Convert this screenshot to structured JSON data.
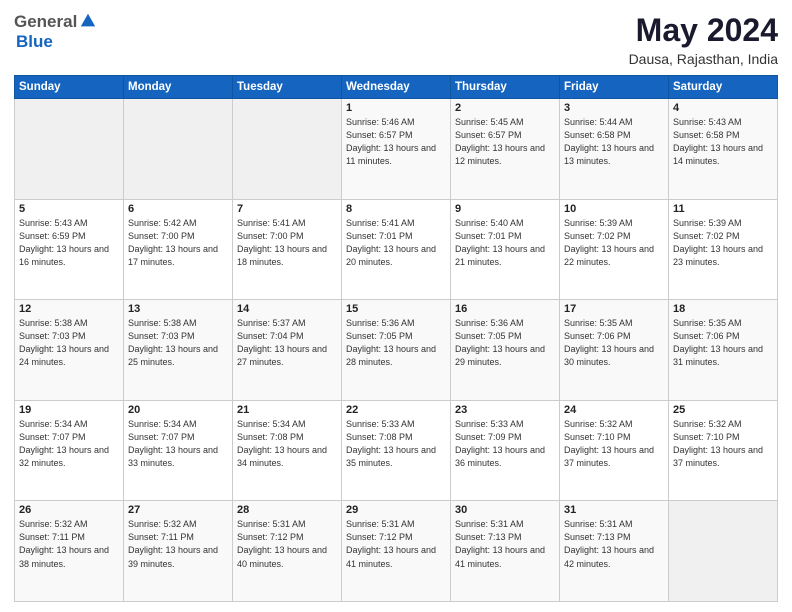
{
  "logo": {
    "general": "General",
    "blue": "Blue"
  },
  "title": "May 2024",
  "subtitle": "Dausa, Rajasthan, India",
  "days_header": [
    "Sunday",
    "Monday",
    "Tuesday",
    "Wednesday",
    "Thursday",
    "Friday",
    "Saturday"
  ],
  "weeks": [
    [
      {
        "day": "",
        "info": ""
      },
      {
        "day": "",
        "info": ""
      },
      {
        "day": "",
        "info": ""
      },
      {
        "day": "1",
        "info": "Sunrise: 5:46 AM\nSunset: 6:57 PM\nDaylight: 13 hours\nand 11 minutes."
      },
      {
        "day": "2",
        "info": "Sunrise: 5:45 AM\nSunset: 6:57 PM\nDaylight: 13 hours\nand 12 minutes."
      },
      {
        "day": "3",
        "info": "Sunrise: 5:44 AM\nSunset: 6:58 PM\nDaylight: 13 hours\nand 13 minutes."
      },
      {
        "day": "4",
        "info": "Sunrise: 5:43 AM\nSunset: 6:58 PM\nDaylight: 13 hours\nand 14 minutes."
      }
    ],
    [
      {
        "day": "5",
        "info": "Sunrise: 5:43 AM\nSunset: 6:59 PM\nDaylight: 13 hours\nand 16 minutes."
      },
      {
        "day": "6",
        "info": "Sunrise: 5:42 AM\nSunset: 7:00 PM\nDaylight: 13 hours\nand 17 minutes."
      },
      {
        "day": "7",
        "info": "Sunrise: 5:41 AM\nSunset: 7:00 PM\nDaylight: 13 hours\nand 18 minutes."
      },
      {
        "day": "8",
        "info": "Sunrise: 5:41 AM\nSunset: 7:01 PM\nDaylight: 13 hours\nand 20 minutes."
      },
      {
        "day": "9",
        "info": "Sunrise: 5:40 AM\nSunset: 7:01 PM\nDaylight: 13 hours\nand 21 minutes."
      },
      {
        "day": "10",
        "info": "Sunrise: 5:39 AM\nSunset: 7:02 PM\nDaylight: 13 hours\nand 22 minutes."
      },
      {
        "day": "11",
        "info": "Sunrise: 5:39 AM\nSunset: 7:02 PM\nDaylight: 13 hours\nand 23 minutes."
      }
    ],
    [
      {
        "day": "12",
        "info": "Sunrise: 5:38 AM\nSunset: 7:03 PM\nDaylight: 13 hours\nand 24 minutes."
      },
      {
        "day": "13",
        "info": "Sunrise: 5:38 AM\nSunset: 7:03 PM\nDaylight: 13 hours\nand 25 minutes."
      },
      {
        "day": "14",
        "info": "Sunrise: 5:37 AM\nSunset: 7:04 PM\nDaylight: 13 hours\nand 27 minutes."
      },
      {
        "day": "15",
        "info": "Sunrise: 5:36 AM\nSunset: 7:05 PM\nDaylight: 13 hours\nand 28 minutes."
      },
      {
        "day": "16",
        "info": "Sunrise: 5:36 AM\nSunset: 7:05 PM\nDaylight: 13 hours\nand 29 minutes."
      },
      {
        "day": "17",
        "info": "Sunrise: 5:35 AM\nSunset: 7:06 PM\nDaylight: 13 hours\nand 30 minutes."
      },
      {
        "day": "18",
        "info": "Sunrise: 5:35 AM\nSunset: 7:06 PM\nDaylight: 13 hours\nand 31 minutes."
      }
    ],
    [
      {
        "day": "19",
        "info": "Sunrise: 5:34 AM\nSunset: 7:07 PM\nDaylight: 13 hours\nand 32 minutes."
      },
      {
        "day": "20",
        "info": "Sunrise: 5:34 AM\nSunset: 7:07 PM\nDaylight: 13 hours\nand 33 minutes."
      },
      {
        "day": "21",
        "info": "Sunrise: 5:34 AM\nSunset: 7:08 PM\nDaylight: 13 hours\nand 34 minutes."
      },
      {
        "day": "22",
        "info": "Sunrise: 5:33 AM\nSunset: 7:08 PM\nDaylight: 13 hours\nand 35 minutes."
      },
      {
        "day": "23",
        "info": "Sunrise: 5:33 AM\nSunset: 7:09 PM\nDaylight: 13 hours\nand 36 minutes."
      },
      {
        "day": "24",
        "info": "Sunrise: 5:32 AM\nSunset: 7:10 PM\nDaylight: 13 hours\nand 37 minutes."
      },
      {
        "day": "25",
        "info": "Sunrise: 5:32 AM\nSunset: 7:10 PM\nDaylight: 13 hours\nand 37 minutes."
      }
    ],
    [
      {
        "day": "26",
        "info": "Sunrise: 5:32 AM\nSunset: 7:11 PM\nDaylight: 13 hours\nand 38 minutes."
      },
      {
        "day": "27",
        "info": "Sunrise: 5:32 AM\nSunset: 7:11 PM\nDaylight: 13 hours\nand 39 minutes."
      },
      {
        "day": "28",
        "info": "Sunrise: 5:31 AM\nSunset: 7:12 PM\nDaylight: 13 hours\nand 40 minutes."
      },
      {
        "day": "29",
        "info": "Sunrise: 5:31 AM\nSunset: 7:12 PM\nDaylight: 13 hours\nand 41 minutes."
      },
      {
        "day": "30",
        "info": "Sunrise: 5:31 AM\nSunset: 7:13 PM\nDaylight: 13 hours\nand 41 minutes."
      },
      {
        "day": "31",
        "info": "Sunrise: 5:31 AM\nSunset: 7:13 PM\nDaylight: 13 hours\nand 42 minutes."
      },
      {
        "day": "",
        "info": ""
      }
    ]
  ]
}
